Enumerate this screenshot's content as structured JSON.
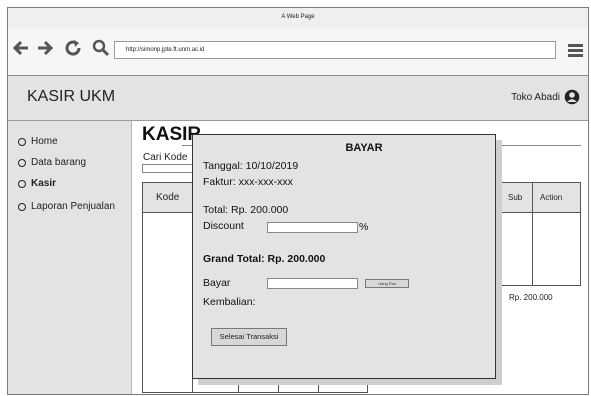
{
  "browser": {
    "window_title": "A Web Page",
    "url": "http://simonp.jpte.ft.unm.ac.id",
    "back_icon": "arrow-left-icon",
    "forward_icon": "arrow-right-icon",
    "reload_icon": "reload-icon",
    "search_icon": "search-icon",
    "menu_icon": "hamburger-menu-icon"
  },
  "header": {
    "app_name": "KASIR UKM",
    "store_name": "Toko Abadi",
    "user_icon": "user-icon"
  },
  "sidebar": {
    "items": [
      {
        "label": "Home",
        "active": false
      },
      {
        "label": "Data barang",
        "active": false
      },
      {
        "label": "Kasir",
        "active": true
      },
      {
        "label": "Laporan Penjualan",
        "active": false
      }
    ]
  },
  "main": {
    "page_title": "KASIR",
    "search_label": "Cari Kode",
    "search_value": "",
    "table": {
      "columns": [
        "Kode",
        "",
        "",
        "",
        "",
        "Sub",
        "Action"
      ],
      "subtotal_value": "Rp. 200.000"
    }
  },
  "modal": {
    "title": "BAYAR",
    "tanggal": "Tanggal: 10/10/2019",
    "faktur": "Faktur: xxx-xxx-xxx",
    "total": "Total: Rp. 200.000",
    "discount_label": "Discount",
    "discount_value": "",
    "discount_unit": "%",
    "grand_total": "Grand Total: Rp. 200.000",
    "bayar_label": "Bayar",
    "bayar_value": "",
    "uang_pas_button": "Uang Pas",
    "kembalian_label": "Kembalian:",
    "selesai_button": "Selesai Transaksi"
  },
  "colors": {
    "sidebar_bg": "#e3e3e3",
    "header_bg": "#e3e3e3",
    "modal_bg": "#e3e3e3",
    "border": "#555555"
  }
}
